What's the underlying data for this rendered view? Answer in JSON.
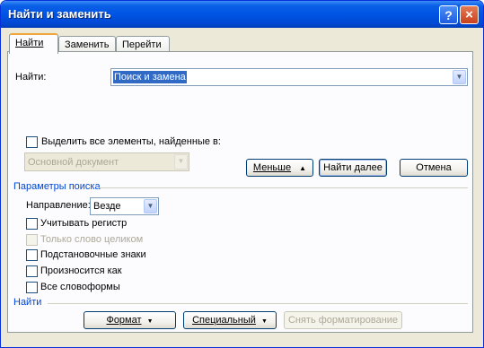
{
  "window": {
    "title": "Найти и заменить",
    "help_glyph": "?",
    "close_glyph": "×"
  },
  "tabs": [
    {
      "label": "Найти",
      "active": true
    },
    {
      "label": "Заменить",
      "active": false
    },
    {
      "label": "Перейти",
      "active": false
    }
  ],
  "find": {
    "label": "Найти:",
    "value": "Поиск и замена"
  },
  "highlight": {
    "checkbox_label": "Выделить все элементы, найденные в:",
    "checked": false,
    "scope_value": "Основной документ"
  },
  "buttons": {
    "less": "Меньше",
    "less_arrow": "▲",
    "find_next": "Найти далее",
    "cancel": "Отмена",
    "format": "Формат",
    "special": "Специальный",
    "clear_formatting": "Снять форматирование",
    "dropdown_glyph": "▼"
  },
  "options": {
    "section_title": "Параметры поиска",
    "direction_label": "Направление:",
    "direction_value": "Везде",
    "checkboxes": [
      {
        "label": "Учитывать регистр",
        "checked": false,
        "enabled": true
      },
      {
        "label": "Только слово целиком",
        "checked": false,
        "enabled": false
      },
      {
        "label": "Подстановочные знаки",
        "checked": false,
        "enabled": true
      },
      {
        "label": "Произносится как",
        "checked": false,
        "enabled": true
      },
      {
        "label": "Все словоформы",
        "checked": false,
        "enabled": true
      }
    ]
  },
  "find_section_title": "Найти",
  "colors": {
    "title_bar": "#0054e3",
    "section_title": "#0046d5",
    "dialog_bg": "#ece9d8",
    "selection": "#316ac5"
  }
}
